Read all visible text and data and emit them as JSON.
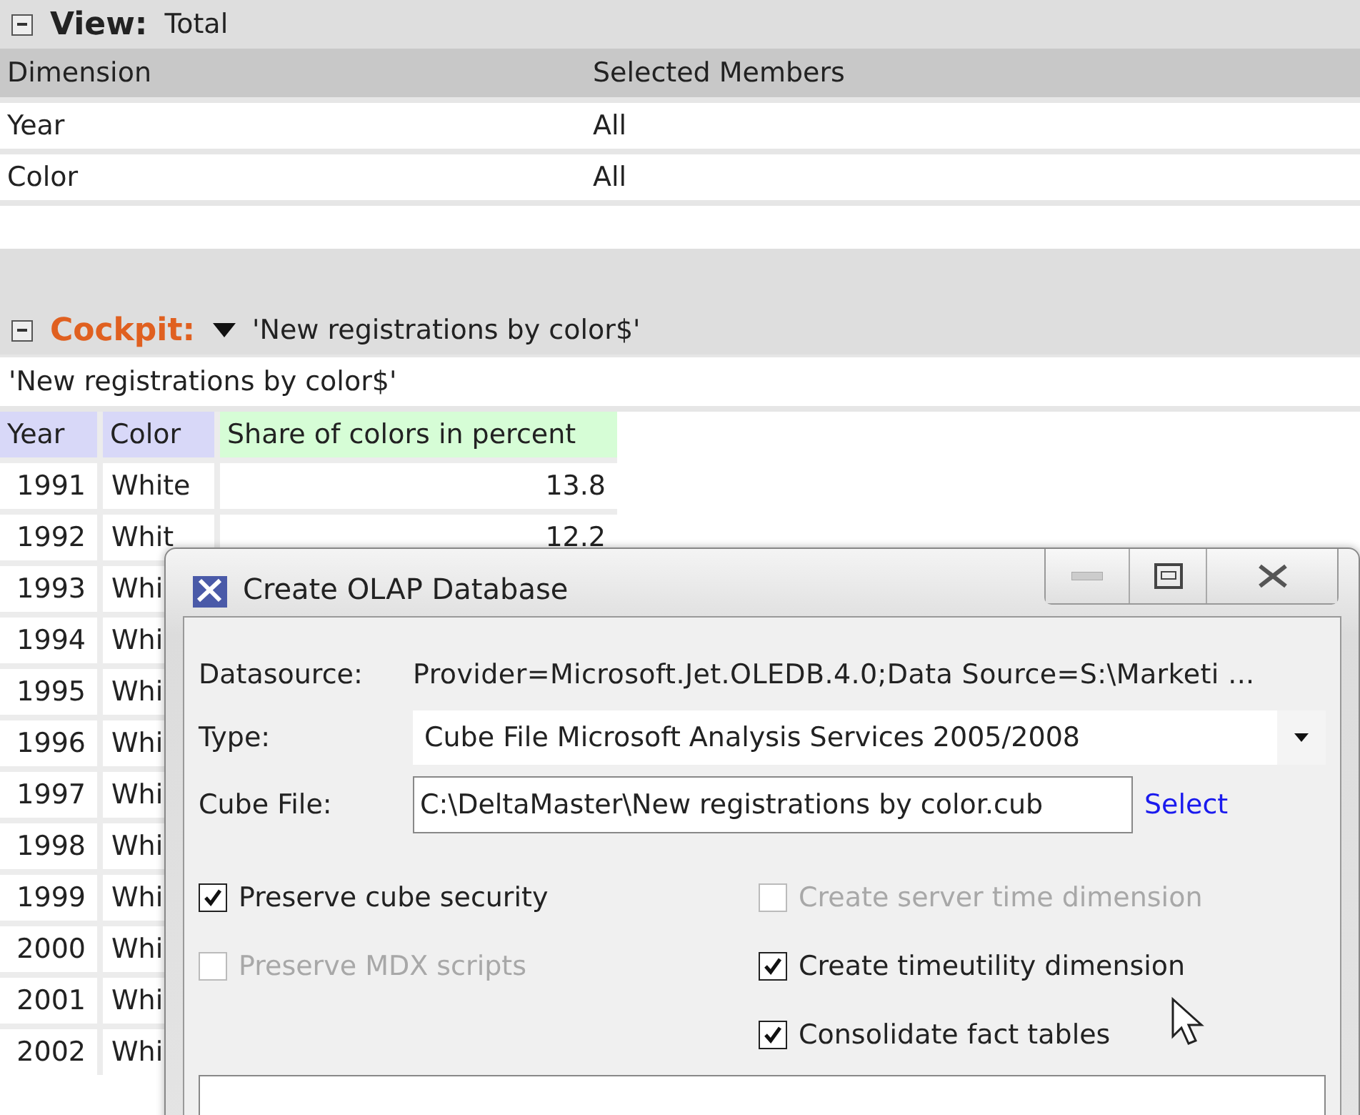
{
  "view": {
    "label": "View:",
    "value": "Total",
    "expanded": true,
    "columns": [
      "Dimension",
      "Selected Members"
    ],
    "rows": [
      [
        "Year",
        "All"
      ],
      [
        "Color",
        "All"
      ]
    ]
  },
  "cockpit": {
    "label": "Cockpit:",
    "value": "'New registrations by color$'",
    "expanded": true,
    "subtitle": "'New registrations by color$'",
    "columns": [
      "Year",
      "Color",
      "Share of colors in percent"
    ],
    "rows": [
      [
        "1991",
        "White",
        "13.8"
      ],
      [
        "1992",
        "Whit",
        "12.2"
      ],
      [
        "1993",
        "Whi"
      ],
      [
        "1994",
        "Whi"
      ],
      [
        "1995",
        "Whi"
      ],
      [
        "1996",
        "Whi"
      ],
      [
        "1997",
        "Whi"
      ],
      [
        "1998",
        "Whi"
      ],
      [
        "1999",
        "Whi"
      ],
      [
        "2000",
        "Whi"
      ],
      [
        "2001",
        "Whi"
      ],
      [
        "2002",
        "Whi"
      ]
    ]
  },
  "dialog": {
    "title": "Create OLAP Database",
    "datasource_label": "Datasource:",
    "datasource": "Provider=Microsoft.Jet.OLEDB.4.0;Data Source=S:\\Marketi ...",
    "type_label": "Type:",
    "type": "Cube File Microsoft Analysis Services 2005/2008",
    "cube_label": "Cube File:",
    "cube_file": "C:\\DeltaMaster\\New registrations by color.cub",
    "select_link": "Select",
    "options_left": [
      {
        "label": "Preserve cube security",
        "checked": true,
        "disabled": false
      },
      {
        "label": "Preserve MDX scripts",
        "checked": false,
        "disabled": true
      }
    ],
    "options_right": [
      {
        "label": "Create server time dimension",
        "checked": false,
        "disabled": true
      },
      {
        "label": "Create timeutility dimension",
        "checked": true,
        "disabled": false
      },
      {
        "label": "Consolidate fact tables",
        "checked": true,
        "disabled": false
      }
    ]
  }
}
